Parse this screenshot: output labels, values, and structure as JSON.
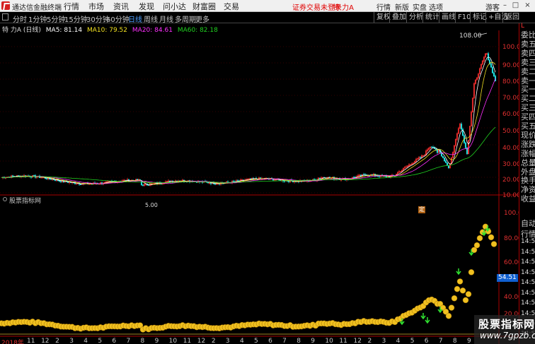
{
  "app": {
    "title": "通达信金融终端"
  },
  "menu": [
    "行情",
    "市场",
    "资讯",
    "发现",
    "问小达",
    "财富圈",
    "交易"
  ],
  "login_warning": "证券交易未登录",
  "stock_tag": "特 力A",
  "top_right": [
    "行情",
    "新版",
    "实盘",
    "选项",
    "游客"
  ],
  "periods": [
    "分时",
    "1分钟",
    "5分钟",
    "15分钟",
    "30分钟",
    "60分钟",
    "日线",
    "周线",
    "月线",
    "多周期",
    "更多"
  ],
  "active_period": "日线",
  "right_tools": [
    "复权",
    "叠加",
    "分析",
    "统计",
    "画线",
    "F10",
    "标记",
    "+自选",
    "返回"
  ],
  "ma_legend": {
    "name": "特 力A (日线)",
    "ma5": "MA5: 81.14",
    "ma10": "MA10: 79.52",
    "ma20": "MA20: 84.61",
    "ma60": "MA60: 82.18"
  },
  "colors": {
    "ma5": "#ffffff",
    "ma10": "#f0e020",
    "ma20": "#ff30ff",
    "ma60": "#20d020",
    "up": "#ff3030",
    "down": "#20e0e0"
  },
  "price_axis": [
    "100.0",
    "90.00",
    "80.00",
    "70.00",
    "60.00",
    "50.00",
    "40.00",
    "30.00",
    "20.00",
    "10.00"
  ],
  "sub_axis": [
    "100.0",
    "80.00",
    "60.00",
    "40.00",
    "20.00"
  ],
  "peak_label": "108.00",
  "low_label": "5.00",
  "marker": "定",
  "sub_title": "股票指标网",
  "current_value": "54.51",
  "right_panel": [
    "委比",
    "卖五",
    "卖四",
    "卖三",
    "卖二",
    "卖一",
    "买一",
    "买二",
    "买三",
    "买四",
    "买五",
    "现价",
    "涨跌",
    "涨幅",
    "总量",
    "外盘",
    "换手",
    "净资",
    "收益"
  ],
  "right_panel_sub": [
    "自动",
    "行情",
    "14:59",
    "14:58",
    "14:58",
    "14:58",
    "14:58",
    "14:58",
    "14:58",
    "14:58",
    "14:58",
    "14:58"
  ],
  "year_label": "2018年",
  "months": [
    "11",
    "12",
    "2",
    "3",
    "4",
    "5",
    "6",
    "7",
    "8",
    "9",
    "10",
    "11",
    "12",
    "2",
    "3",
    "4",
    "5",
    "6",
    "7",
    "8",
    "9",
    "10",
    "11",
    "12",
    "2",
    "3",
    "4",
    "5",
    "6",
    "7",
    "8",
    "9"
  ],
  "watermark": {
    "line1": "股票指标网",
    "line2": "www.7gpzb.com"
  }
}
